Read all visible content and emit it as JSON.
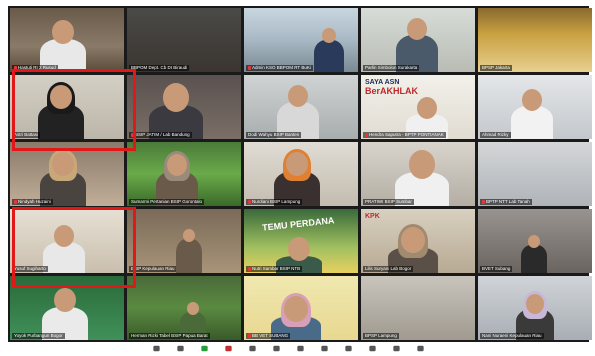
{
  "tiles": [
    {
      "name": "Hastuti RI 2 Rusud",
      "muted": true
    },
    {
      "name": "BBPOM Dept. Cb DI Biraudi",
      "muted": false
    },
    {
      "name": "Admin KSO BBPOM RT BuKi",
      "muted": true
    },
    {
      "name": "Parlin Simbolon Surakarta",
      "muted": false
    },
    {
      "name": "BPSP Jakarta",
      "muted": false
    },
    {
      "name": "Astri Battasi",
      "muted": false
    },
    {
      "name": "BSIP JATIM / Lab Bandung",
      "muted": true
    },
    {
      "name": "Dodi Wahyu BSIP Banten",
      "muted": false
    },
    {
      "name": "Hendra Saputra - BPTP PONTIANAK",
      "muted": true
    },
    {
      "name": "Ahmad Rizky",
      "muted": false
    },
    {
      "name": "Nindyah Huzaini",
      "muted": true
    },
    {
      "name": "Sumarmi Pertanian BSIP Gorontalo",
      "muted": false
    },
    {
      "name": "Nurdiani BSIP Lampung",
      "muted": true
    },
    {
      "name": "PRATIWI BSIP Sumbar",
      "muted": false
    },
    {
      "name": "BPTP NTT Lab Tanah",
      "muted": true
    },
    {
      "name": "Yusuf Sugiharto",
      "muted": false
    },
    {
      "name": "BSIP Kepulauan Riau",
      "muted": false
    },
    {
      "name": "Nutri Sambar BSIP NTB",
      "muted": true
    },
    {
      "name": "Lilis Suryani Lab Bogor",
      "muted": false
    },
    {
      "name": "BVET Subang",
      "muted": false
    },
    {
      "name": "Yoyok Purbangun Bogor",
      "muted": false
    },
    {
      "name": "Herman Rizki Tabel BSIP Papua Barat",
      "muted": false
    },
    {
      "name": "BB VET SUBANG",
      "muted": true
    },
    {
      "name": "BPSP Lampung",
      "muted": false
    },
    {
      "name": "Nani Nuraeni Kepulauan Riau",
      "muted": false
    }
  ],
  "banners": {
    "saya_asn_1": "SAYA ASN",
    "saya_asn_2": "BerAKHLAK",
    "temu_perdana": "TEMU PERDANA",
    "kpk": "KPK"
  },
  "colors": {
    "highlight": "#e01818",
    "stage": "#1a1a1a"
  },
  "toolbar": {
    "icons": [
      "participants-icon",
      "chat-icon",
      "share-screen-icon",
      "record-icon",
      "reactions-icon",
      "apps-icon",
      "whiteboard-icon",
      "more-icon",
      "notes-icon",
      "caption-icon",
      "settings-icon",
      "end-icon"
    ]
  }
}
